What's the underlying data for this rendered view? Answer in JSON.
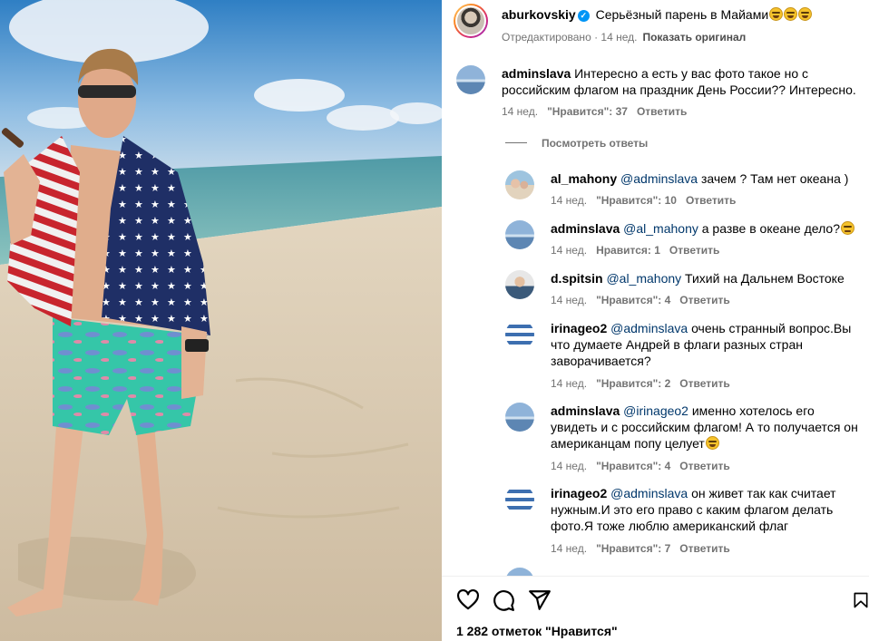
{
  "post": {
    "username": "aburkovskiy",
    "caption": "Серьёзный парень в Майами",
    "edited": "Отредактировано · 14 нед.",
    "show_original": "Показать оригинал"
  },
  "comments": [
    {
      "user": "adminslava",
      "mention": "",
      "text": "Интересно а есть у вас фото такое но с российским флагом на праздник День России?? Интересно.",
      "time": "14 нед.",
      "likes": "\"Нравится\": 37",
      "reply": "Ответить"
    },
    {
      "user": "al_mahony",
      "mention": "@adminslava",
      "text": "зачем ? Там нет океана )",
      "time": "14 нед.",
      "likes": "\"Нравится\": 10",
      "reply": "Ответить"
    },
    {
      "user": "adminslava",
      "mention": "@al_mahony",
      "text": "а разве в океане дело?",
      "time": "14 нед.",
      "likes": "Нравится: 1",
      "reply": "Ответить"
    },
    {
      "user": "d.spitsin",
      "mention": "@al_mahony",
      "text": "Тихий на Дальнем Востоке",
      "time": "14 нед.",
      "likes": "\"Нравится\": 4",
      "reply": "Ответить"
    },
    {
      "user": "irinageo2",
      "mention": "@adminslava",
      "text": "очень странный вопрос.Вы что думаете Андрей в флаги разных стран заворачивается?",
      "time": "14 нед.",
      "likes": "\"Нравится\": 2",
      "reply": "Ответить"
    },
    {
      "user": "adminslava",
      "mention": "@irinageo2",
      "text": "именно хотелось его увидеть и с российским флагом! А то получается он американцам попу целует",
      "time": "14 нед.",
      "likes": "\"Нравится\": 4",
      "reply": "Ответить"
    },
    {
      "user": "irinageo2",
      "mention": "@adminslava",
      "text": "он живет так как считает нужным.И это его право с каким флагом делать фото.Я тоже люблю американский флаг",
      "time": "14 нед.",
      "likes": "\"Нравится\": 7",
      "reply": "Ответить"
    }
  ],
  "view_replies": "Посмотреть ответы",
  "likes_total": "1 282 отметок \"Нравится\"",
  "icons": {
    "like": "heart-icon",
    "comment": "comment-icon",
    "share": "share-icon",
    "save": "bookmark-icon",
    "verified": "verified-badge-icon",
    "emoji": "grinning-face-emoji"
  },
  "colors": {
    "link": "#00376b",
    "meta": "#737373",
    "verified": "#0095f6"
  }
}
